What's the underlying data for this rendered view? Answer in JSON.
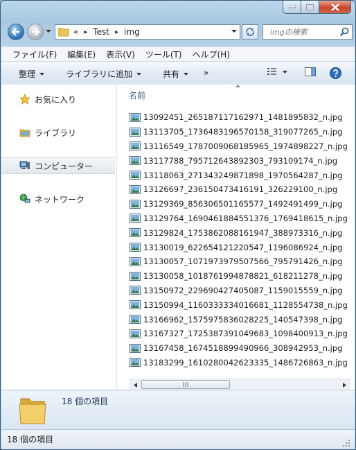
{
  "window": {
    "caption_buttons": [
      "minimize",
      "maximize",
      "close"
    ]
  },
  "address": {
    "overflow": "«",
    "crumbs": [
      "Test",
      "img"
    ],
    "separator": "▸"
  },
  "search": {
    "placeholder": "imgの検索"
  },
  "menu": [
    "ファイル(F)",
    "編集(E)",
    "表示(V)",
    "ツール(T)",
    "ヘルプ(H)"
  ],
  "commands": {
    "organize": "整理",
    "include_library": "ライブラリに追加",
    "share": "共有",
    "more": "»"
  },
  "nav_pane": [
    {
      "label": "お気に入り",
      "icon": "star-icon"
    },
    {
      "label": "ライブラリ",
      "icon": "library-icon"
    },
    {
      "label": "コンピューター",
      "icon": "computer-icon",
      "selected": true
    },
    {
      "label": "ネットワーク",
      "icon": "network-icon"
    }
  ],
  "file_list": {
    "column_header": "名前",
    "files": [
      "13092451_265187117162971_1481895832_n.jpg",
      "13113705_1736483196570158_319077265_n.jpg",
      "13116549_1787009068185965_1974898227_n.jpg",
      "13117788_795712643892303_793109174_n.jpg",
      "13118063_271343249871898_1970564287_n.jpg",
      "13126697_236150473416191_326229100_n.jpg",
      "13129369_856306501165577_1492491499_n.jpg",
      "13129764_1690461884551376_1769418615_n.jpg",
      "13129824_1753862088161947_388973316_n.jpg",
      "13130019_622654121220547_1196086924_n.jpg",
      "13130057_1071973979507566_795791426_n.jpg",
      "13130058_1018761994878821_618211278_n.jpg",
      "13150972_229690427405087_1159015559_n.jpg",
      "13150994_1160333334016681_1128554738_n.jpg",
      "13166962_1575975836028225_140547398_n.jpg",
      "13167327_1725387391049683_1098400913_n.jpg",
      "13167458_1674518899490966_308942953_n.jpg",
      "13183299_1610280042623335_1486726863_n.jpg"
    ]
  },
  "details": {
    "item_count": "18 個の項目"
  },
  "status_bar": {
    "text": "18 個の項目"
  },
  "colors": {
    "accent": "#2c6fb0",
    "close": "#c9472b"
  }
}
